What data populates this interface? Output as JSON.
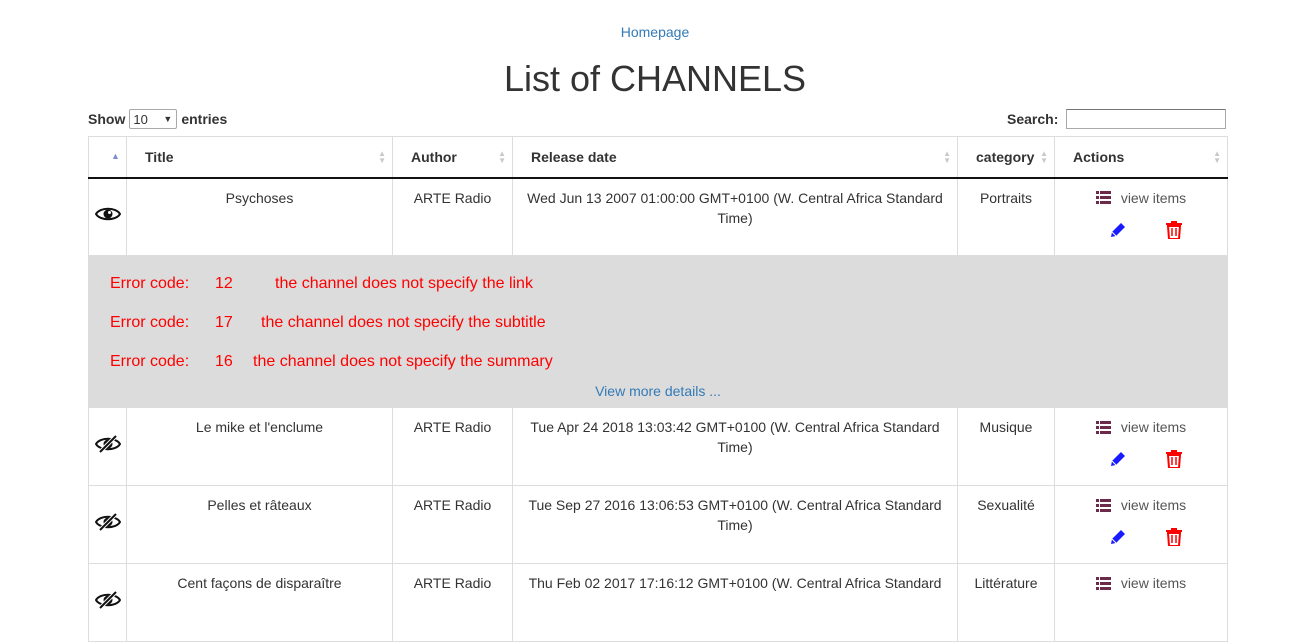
{
  "nav": {
    "home_link": "Homepage"
  },
  "page": {
    "title": "List of CHANNELS"
  },
  "controls": {
    "show_label": "Show",
    "entries_value": "10",
    "entries_label": "entries",
    "search_label": "Search:",
    "search_value": ""
  },
  "table": {
    "columns": [
      "",
      "Title",
      "Author",
      "Release date",
      "category",
      "Actions"
    ],
    "rows": [
      {
        "visibility_icon": "eye-icon",
        "title": "Psychoses",
        "author": "ARTE Radio",
        "release_date": "Wed Jun 13 2007 01:00:00 GMT+0100 (W. Central Africa Standard Time)",
        "category": "Portraits",
        "view_items_label": "view items"
      },
      {
        "visibility_icon": "eye-slash-icon",
        "title": "Le mike et l'enclume",
        "author": "ARTE Radio",
        "release_date": "Tue Apr 24 2018 13:03:42 GMT+0100 (W. Central Africa Standard Time)",
        "category": "Musique",
        "view_items_label": "view items"
      },
      {
        "visibility_icon": "eye-slash-icon",
        "title": "Pelles et râteaux",
        "author": "ARTE Radio",
        "release_date": "Tue Sep 27 2016 13:06:53 GMT+0100 (W. Central Africa Standard Time)",
        "category": "Sexualité",
        "view_items_label": "view items"
      },
      {
        "visibility_icon": "eye-slash-icon",
        "title": "Cent façons de disparaître",
        "author": "ARTE Radio",
        "release_date": "Thu Feb 02 2017 17:16:12 GMT+0100 (W. Central Africa Standard",
        "category": "Littérature",
        "view_items_label": "view items"
      }
    ],
    "error_panel": {
      "errors": [
        {
          "label": "Error code:",
          "code": "12",
          "message": "the channel does not specify the link"
        },
        {
          "label": "Error code:",
          "code": "17",
          "message": "the channel does not specify the subtitle"
        },
        {
          "label": "Error code:",
          "code": "16",
          "message": "the channel does not specify the summary"
        }
      ],
      "more_link": "View more details ..."
    }
  },
  "colors": {
    "link": "#337ab7",
    "error_text": "#ff0000",
    "error_bg": "#dcdcdc",
    "edit_icon": "#1a1aff",
    "delete_icon": "#ff0000",
    "list_icon": "#6b2a4a"
  }
}
